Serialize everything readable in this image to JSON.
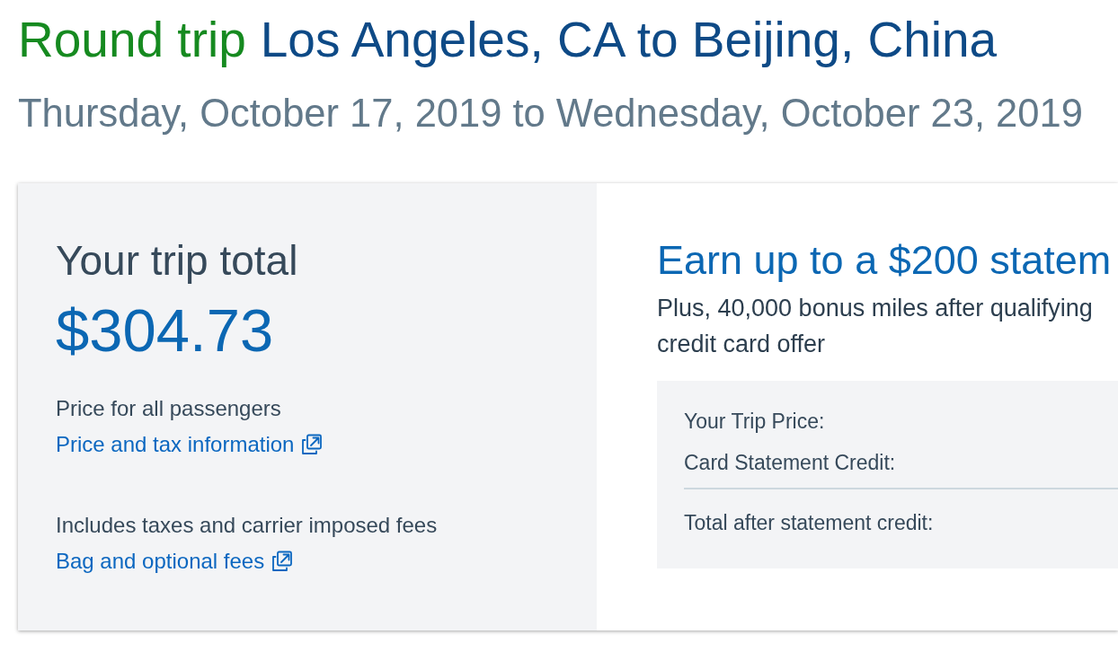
{
  "header": {
    "trip_type": "Round trip",
    "route": "Los Angeles, CA to Beijing, China",
    "dates": "Thursday, October 17, 2019 to Wednesday, October 23, 2019"
  },
  "trip_total": {
    "heading": "Your trip total",
    "amount": "$304.73",
    "sections": [
      {
        "note": "Price for all passengers",
        "link": "Price and tax information"
      },
      {
        "note": "Includes taxes and carrier imposed fees",
        "link": "Bag and optional fees"
      }
    ]
  },
  "card_offer": {
    "heading": "Earn up to a $200 statem",
    "description": "Plus, 40,000 bonus miles after qualifying\ncredit card offer",
    "breakdown": [
      {
        "kind": "item",
        "label": "Your Trip Price:"
      },
      {
        "kind": "item",
        "label": "Card Statement Credit:"
      },
      {
        "kind": "total",
        "label": "Total after statement credit:"
      }
    ]
  }
}
